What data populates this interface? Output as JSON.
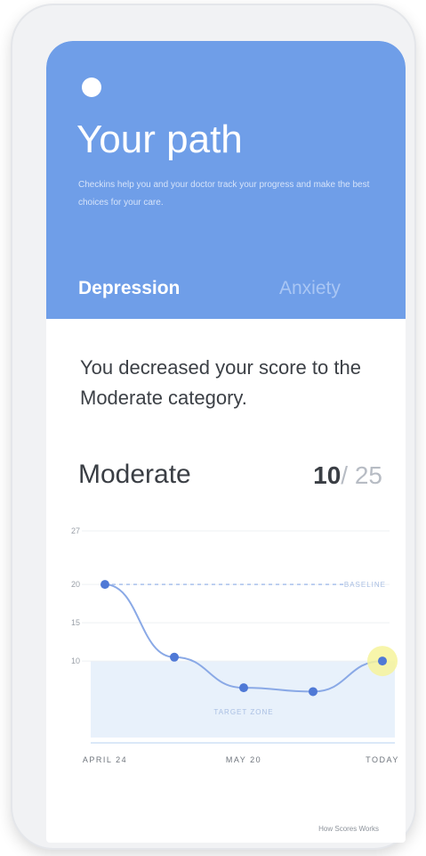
{
  "header": {
    "title": "Your path",
    "subtitle": "Checkins help you and your doctor track your progress and make the best choices for your care.",
    "tabs": [
      {
        "label": "Depression",
        "active": true
      },
      {
        "label": "Anxiety",
        "active": false
      }
    ]
  },
  "summary": {
    "headline": "You decreased your score to the Moderate category."
  },
  "score": {
    "category": "Moderate",
    "value": "10",
    "separator": "/",
    "max": "25"
  },
  "chart_data": {
    "type": "line",
    "x": [
      "APRIL 24",
      "",
      "MAY 20",
      "",
      "TODAY"
    ],
    "series": [
      {
        "values": [
          20,
          10.5,
          6.5,
          6,
          10
        ]
      }
    ],
    "ylim": [
      0,
      27
    ],
    "yticks": [
      27,
      20,
      15,
      10
    ],
    "reference_line": {
      "value": 20,
      "label": "BASELINE"
    },
    "target_band": {
      "from": 0,
      "to": 10,
      "label": "TARGET ZONE"
    },
    "xtick_labels": [
      "APRIL 24",
      "MAY 20",
      "TODAY"
    ],
    "colors": {
      "line": "#8aa9e6",
      "point": "#4f79d6",
      "band": "#e8f1fb",
      "highlight": "#f6f39b"
    }
  },
  "footer": {
    "text": "How Scores Works"
  },
  "colors": {
    "header_bg": "#6f9ee8",
    "accent": "#4f79d6"
  }
}
